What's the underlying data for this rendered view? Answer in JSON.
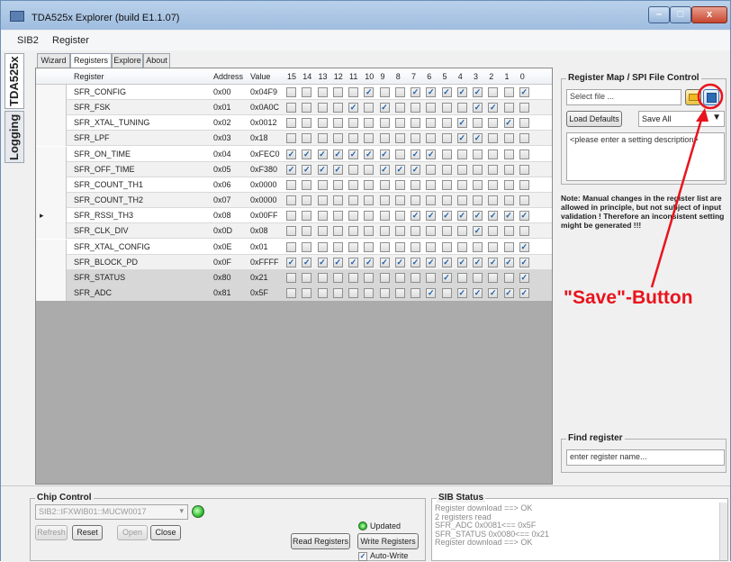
{
  "window": {
    "title": "TDA525x  Explorer (build E1.1.07)",
    "min": "–",
    "max": "□",
    "close": "x"
  },
  "menu": [
    "SIB2",
    "Register"
  ],
  "side_tabs": [
    "TDA525x",
    "Logging"
  ],
  "tabs": [
    "Wizard",
    "Registers",
    "Explore",
    "About"
  ],
  "grid": {
    "headers": {
      "register": "Register",
      "address": "Address",
      "value": "Value",
      "bits": [
        "15",
        "14",
        "13",
        "12",
        "11",
        "10",
        "9",
        "8",
        "7",
        "6",
        "5",
        "4",
        "3",
        "2",
        "1",
        "0"
      ]
    },
    "rows": [
      {
        "name": "SFR_CONFIG",
        "address": "0x00",
        "value": "0x04F9",
        "bits": [
          0,
          0,
          0,
          0,
          0,
          1,
          0,
          0,
          1,
          1,
          1,
          1,
          1,
          0,
          0,
          1
        ],
        "style": "normal"
      },
      {
        "name": "SFR_FSK",
        "address": "0x01",
        "value": "0x0A0C",
        "bits": [
          0,
          0,
          0,
          0,
          1,
          0,
          1,
          0,
          0,
          0,
          0,
          0,
          1,
          1,
          0,
          0
        ],
        "style": "alt"
      },
      {
        "name": "SFR_XTAL_TUNING",
        "address": "0x02",
        "value": "0x0012",
        "bits": [
          0,
          0,
          0,
          0,
          0,
          0,
          0,
          0,
          0,
          0,
          0,
          1,
          0,
          0,
          1,
          0
        ],
        "style": "normal"
      },
      {
        "name": "SFR_LPF",
        "address": "0x03",
        "value": "0x18",
        "bits": [
          0,
          0,
          0,
          0,
          0,
          0,
          0,
          0,
          0,
          0,
          0,
          1,
          1,
          0,
          0,
          0
        ],
        "style": "alt"
      },
      {
        "name": "SFR_ON_TIME",
        "address": "0x04",
        "value": "0xFEC0",
        "bits": [
          1,
          1,
          1,
          1,
          1,
          1,
          1,
          0,
          1,
          1,
          0,
          0,
          0,
          0,
          0,
          0
        ],
        "style": "normal"
      },
      {
        "name": "SFR_OFF_TIME",
        "address": "0x05",
        "value": "0xF380",
        "bits": [
          1,
          1,
          1,
          1,
          0,
          0,
          1,
          1,
          1,
          0,
          0,
          0,
          0,
          0,
          0,
          0
        ],
        "style": "alt"
      },
      {
        "name": "SFR_COUNT_TH1",
        "address": "0x06",
        "value": "0x0000",
        "bits": [
          0,
          0,
          0,
          0,
          0,
          0,
          0,
          0,
          0,
          0,
          0,
          0,
          0,
          0,
          0,
          0
        ],
        "style": "normal"
      },
      {
        "name": "SFR_COUNT_TH2",
        "address": "0x07",
        "value": "0x0000",
        "bits": [
          0,
          0,
          0,
          0,
          0,
          0,
          0,
          0,
          0,
          0,
          0,
          0,
          0,
          0,
          0,
          0
        ],
        "style": "alt"
      },
      {
        "name": "SFR_RSSI_TH3",
        "address": "0x08",
        "value": "0x00FF",
        "bits": [
          0,
          0,
          0,
          0,
          0,
          0,
          0,
          0,
          1,
          1,
          1,
          1,
          1,
          1,
          1,
          1
        ],
        "style": "normal",
        "selected": true
      },
      {
        "name": "SFR_CLK_DIV",
        "address": "0x0D",
        "value": "0x08",
        "bits": [
          0,
          0,
          0,
          0,
          0,
          0,
          0,
          0,
          0,
          0,
          0,
          0,
          1,
          0,
          0,
          0
        ],
        "style": "alt"
      },
      {
        "name": "SFR_XTAL_CONFIG",
        "address": "0x0E",
        "value": "0x01",
        "bits": [
          0,
          0,
          0,
          0,
          0,
          0,
          0,
          0,
          0,
          0,
          0,
          0,
          0,
          0,
          0,
          1
        ],
        "style": "normal"
      },
      {
        "name": "SFR_BLOCK_PD",
        "address": "0x0F",
        "value": "0xFFFF",
        "bits": [
          1,
          1,
          1,
          1,
          1,
          1,
          1,
          1,
          1,
          1,
          1,
          1,
          1,
          1,
          1,
          1
        ],
        "style": "alt"
      },
      {
        "name": "SFR_STATUS",
        "address": "0x80",
        "value": "0x21",
        "bits": [
          0,
          0,
          0,
          0,
          0,
          0,
          0,
          0,
          0,
          0,
          1,
          0,
          0,
          0,
          0,
          1
        ],
        "style": "gray"
      },
      {
        "name": "SFR_ADC",
        "address": "0x81",
        "value": "0x5F",
        "bits": [
          0,
          0,
          0,
          0,
          0,
          0,
          0,
          0,
          0,
          1,
          0,
          1,
          1,
          1,
          1,
          1
        ],
        "style": "gray"
      }
    ]
  },
  "right": {
    "group_title": "Register Map / SPI File Control",
    "file_placeholder": "Select file ...",
    "load_defaults": "Load Defaults",
    "save_select": "Save All",
    "description": "<please enter a setting description>",
    "note": "Note: Manual changes in the register list are allowed in principle, but not subject of input validation ! Therefore an inconsistent setting might be generated !!!",
    "find_title": "Find register",
    "find_placeholder": "enter register name..."
  },
  "annotation": {
    "text": "\"Save\"-Button",
    "color": "#e8141d"
  },
  "chip": {
    "title": "Chip Control",
    "device": "SIB2::IFXWIB01::MUCW0017",
    "refresh": "Refresh",
    "reset": "Reset",
    "open": "Open",
    "close": "Close",
    "updated": "Updated",
    "read": "Read Registers",
    "write": "Write Registers",
    "auto_write": "Auto-Write"
  },
  "sib": {
    "title": "SIB Status",
    "log": [
      "Register download ==> OK",
      "2 registers read",
      "SFR_ADC 0x0081<== 0x5F",
      "SFR_STATUS 0x0080<== 0x21",
      "Register download ==> OK"
    ]
  },
  "colors": {
    "checked": "#1b5ea8",
    "led": "#34c134",
    "accent": "#e8141d"
  }
}
